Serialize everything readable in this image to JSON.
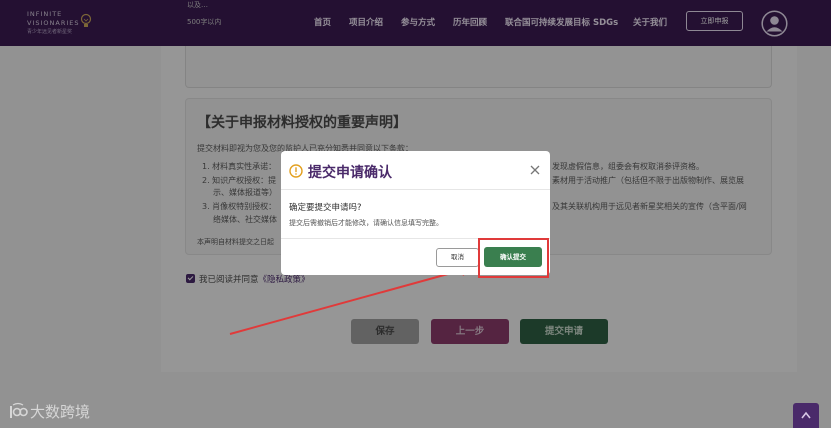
{
  "header": {
    "logo_line1": "INFINITE",
    "logo_line2": "VISIONARIES",
    "logo_sub": "青少年远见者新星奖",
    "nav": [
      "首页",
      "项目介绍",
      "参与方式",
      "历年回顾",
      "联合国可持续发展目标 SDGs",
      "关于我们"
    ],
    "apply_label": "立即申报"
  },
  "form": {
    "faded_line1": "以及…",
    "faded_line2": "500字以内",
    "declaration_title": "【关于申报材料授权的重要声明】",
    "declaration_intro": "提交材料即视为您及您的监护人已充分知悉并同意以下条款：",
    "terms": [
      "1. 材料真实性承诺：",
      "2. 知识产权授权：提",
      "示、媒体报道等）",
      "3. 肖像权特别授权：",
      "络媒体、社交媒体"
    ],
    "terms_right": [
      "发现虚假信息，组委会有权取消参评资格。",
      "素材用于活动推广（包括但不限于出版物制作、展览展",
      "及其关联机构用于远见者新星奖相关的宣传（含平面/网"
    ],
    "declaration_footer": "本声明自材料提交之日起",
    "consent_text": "我已阅读并同意",
    "consent_link": "《隐私政策》",
    "save_label": "保存",
    "prev_label": "上一步",
    "submit_label": "提交申请"
  },
  "modal": {
    "title": "提交申请确认",
    "question": "确定要提交申请吗?",
    "note": "提交后需撤销后才能修改，请确认信息填写完整。",
    "cancel_label": "取消",
    "confirm_label": "确认提交"
  },
  "watermark": {
    "text": "大数跨境"
  },
  "colors": {
    "header_bg": "#3b1b52",
    "brand_purple": "#4a2a6a",
    "confirm_green": "#3a7f4f",
    "highlight_red": "#e03a3a"
  }
}
